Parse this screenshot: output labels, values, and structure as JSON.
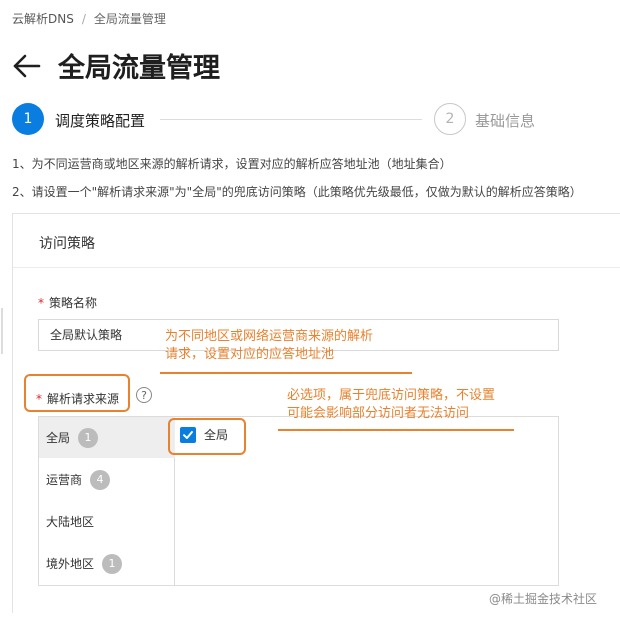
{
  "breadcrumb": {
    "root": "云解析DNS",
    "separator": "/",
    "current": "全局流量管理"
  },
  "header": {
    "back_icon": "arrow-left-icon",
    "title": "全局流量管理"
  },
  "steps": [
    {
      "number": "1",
      "label": "调度策略配置",
      "state": "active"
    },
    {
      "number": "2",
      "label": "基础信息",
      "state": "pending"
    }
  ],
  "notes": [
    "1、为不同运营商或地区来源的解析请求，设置对应的解析应答地址池（地址集合）",
    "2、请设置一个\"解析请求来源\"为\"全局\"的兜底访问策略（此策略优先级最低，仅做为默认的解析应答策略）"
  ],
  "panel": {
    "title": "访问策略",
    "name_field": {
      "required_mark": "*",
      "label": "策略名称",
      "value": "全局默认策略"
    },
    "source_field": {
      "required_mark": "*",
      "label": "解析请求来源",
      "help_icon": "question-circle-icon",
      "help_glyph": "?"
    },
    "source_categories": [
      {
        "label": "全局",
        "count": "1",
        "active": true
      },
      {
        "label": "运营商",
        "count": "4",
        "active": false
      },
      {
        "label": "大陆地区",
        "count": "",
        "active": false
      },
      {
        "label": "境外地区",
        "count": "1",
        "active": false
      }
    ],
    "selected_options": [
      {
        "label": "全局",
        "checked": true
      }
    ]
  },
  "annotations": {
    "note_source": "为不同地区或网络运营商来源的解析\n请求，设置对应的应答地址池",
    "note_option": "必选项，属于兜底访问策略，不设置\n可能会影响部分访问者无法访问"
  },
  "colors": {
    "primary": "#0a7de0",
    "annotation": "#e8822e",
    "required": "#e0262c"
  },
  "watermark": "@稀土掘金技术社区"
}
